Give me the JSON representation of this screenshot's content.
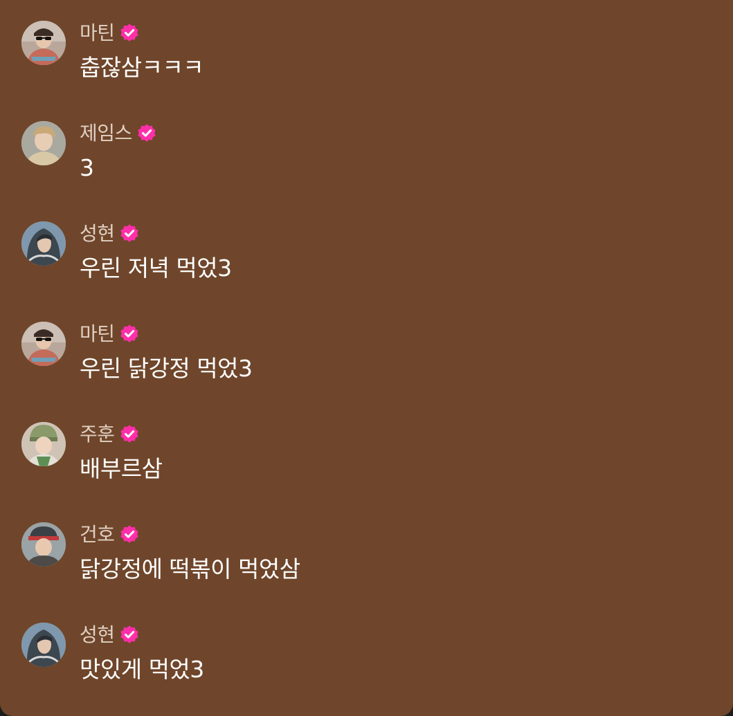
{
  "colors": {
    "background": "#6f462b",
    "name_text": "#e0cfc2",
    "message_text": "#ffffff",
    "verified_badge": "#ff2fa9"
  },
  "comments": [
    {
      "name": "마틴",
      "verified": true,
      "message": "춥잖삼ㅋㅋㅋ",
      "avatar_icon": "avatar-icon"
    },
    {
      "name": "제임스",
      "verified": true,
      "message": "3",
      "avatar_icon": "avatar-icon"
    },
    {
      "name": "성현",
      "verified": true,
      "message": "우린 저녁 먹었3",
      "avatar_icon": "avatar-icon"
    },
    {
      "name": "마틴",
      "verified": true,
      "message": "우린 닭강정 먹었3",
      "avatar_icon": "avatar-icon"
    },
    {
      "name": "주훈",
      "verified": true,
      "message": "배부르삼",
      "avatar_icon": "avatar-icon"
    },
    {
      "name": "건호",
      "verified": true,
      "message": "닭강정에 떡볶이 먹었삼",
      "avatar_icon": "avatar-icon"
    },
    {
      "name": "성현",
      "verified": true,
      "message": "맛있게 먹었3",
      "avatar_icon": "avatar-icon"
    }
  ]
}
